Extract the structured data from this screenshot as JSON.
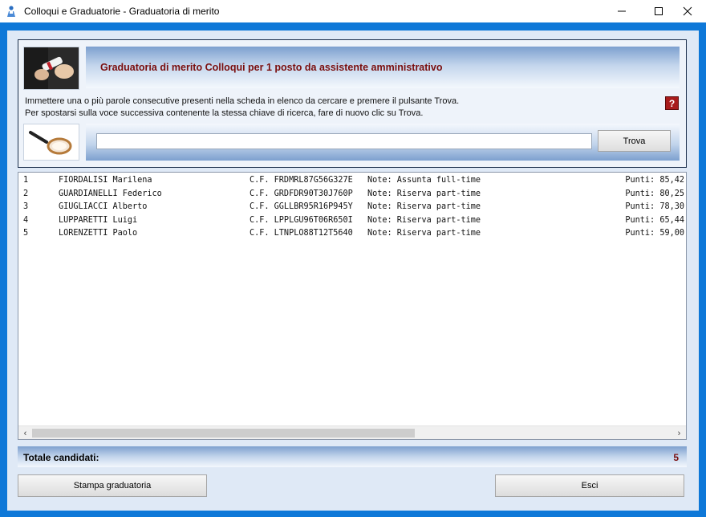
{
  "window": {
    "title": "Colloqui e Graduatorie - Graduatoria di merito",
    "icon": "app-person-icon"
  },
  "header": {
    "title": "Graduatoria di merito Colloqui per 1 posto da assistente amministrativo",
    "instructions_line1": "Immettere una o più parole consecutive presenti nella scheda in elenco da cercare e premere il pulsante Trova.",
    "instructions_line2": "Per spostarsi sulla voce successiva contenente la stessa chiave di ricerca, fare di nuovo clic su Trova.",
    "help_label": "?"
  },
  "search": {
    "value": "",
    "placeholder": "",
    "button_label": "Trova"
  },
  "list": {
    "rows": [
      {
        "num": "1",
        "name": "FIORDALISI Marilena",
        "cf": "C.F. FRDMRL87G56G327E",
        "note": "Note: Assunta full-time",
        "punti": "Punti: 85,42"
      },
      {
        "num": "2",
        "name": "GUARDIANELLI Federico",
        "cf": "C.F. GRDFDR90T30J760P",
        "note": "Note: Riserva part-time",
        "punti": "Punti: 80,25"
      },
      {
        "num": "3",
        "name": "GIUGLIACCI Alberto",
        "cf": "C.F. GGLLBR95R16P945Y",
        "note": "Note: Riserva part-time",
        "punti": "Punti: 78,30"
      },
      {
        "num": "4",
        "name": "LUPPARETTI Luigi",
        "cf": "C.F. LPPLGU96T06R650I",
        "note": "Note: Riserva part-time",
        "punti": "Punti: 65,44"
      },
      {
        "num": "5",
        "name": "LORENZETTI Paolo",
        "cf": "C.F. LTNPLO88T12T5640",
        "note": "Note: Riserva part-time",
        "punti": "Punti: 59,00"
      }
    ]
  },
  "footer": {
    "total_label": "Totale candidati:",
    "total_value": "5",
    "print_label": "Stampa graduatoria",
    "exit_label": "Esci"
  },
  "colors": {
    "accent_title": "#7a0e0e",
    "window_border": "#0e78d8",
    "band_blue": "#7da0cf"
  }
}
